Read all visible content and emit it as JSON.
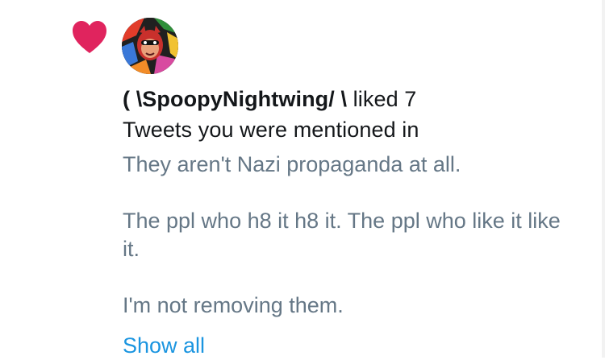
{
  "notification": {
    "type_icon": "heart-icon",
    "accent_color": "#e0245e",
    "avatar": "user-avatar",
    "username": "( \\SpoopyNightwing/ \\",
    "action_text": "liked 7",
    "action_text_line2": "Tweets you were mentioned in",
    "tweet_text": "They aren't Nazi propaganda at all.\n\nThe ppl who h8 it h8 it. The ppl who like it like it.\n\nI'm not removing them.",
    "show_all_label": "Show all",
    "link_color": "#1b95e0"
  }
}
